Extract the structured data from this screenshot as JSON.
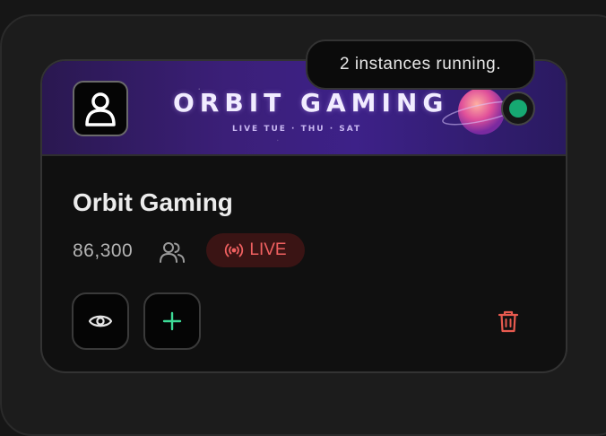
{
  "banner": {
    "title": "ORBIT GAMING",
    "subtitle": "LIVE TUE · THU · SAT"
  },
  "tooltip": {
    "text": "2 instances running."
  },
  "channel": {
    "name": "Orbit Gaming",
    "viewers": "86,300",
    "live_label": "LIVE",
    "status": "online"
  },
  "icons": {
    "avatar": "user-icon",
    "viewers": "users-icon",
    "live": "broadcast-icon",
    "view": "eye-icon",
    "add": "plus-icon",
    "delete": "trash-icon"
  },
  "colors": {
    "status_online": "#16a872",
    "live": "#f06060",
    "add": "#3ddc97",
    "delete": "#e85a4f"
  }
}
